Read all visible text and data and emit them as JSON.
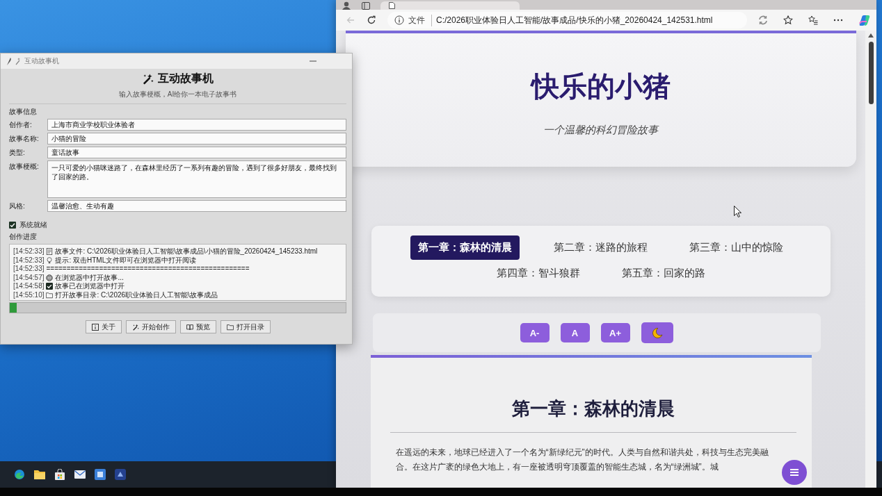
{
  "app_window": {
    "title": "互动故事机",
    "heading": "互动故事机",
    "subtitle": "输入故事梗概，AI给你一本电子故事书",
    "section_title": "故事信息",
    "fields": [
      {
        "label": "创作者:",
        "value": "上海市商业学校职业体验者",
        "kind": "line"
      },
      {
        "label": "故事名称:",
        "value": "小猫的冒险",
        "kind": "line"
      },
      {
        "label": "类型:",
        "value": "童话故事",
        "kind": "line"
      },
      {
        "label": "故事梗概:",
        "value": "一只可爱的小猫咪迷路了，在森林里经历了一系列有趣的冒险，遇到了很多好朋友，最终找到了回家的路。",
        "kind": "area"
      },
      {
        "label": "风格:",
        "value": "温馨治愈、生动有趣",
        "kind": "line"
      }
    ],
    "status": {
      "label": "系统就绪",
      "checked": true
    },
    "log_title": "创作进度",
    "log": [
      {
        "time": "[14:52:33]",
        "kind": "document",
        "text": "故事文件: C:\\2026职业体验日人工智能\\故事成品\\小猫的冒险_20260424_145233.html"
      },
      {
        "time": "[14:52:33]",
        "kind": "tip",
        "text": "提示: 双击HTML文件即可在浏览器中打开阅读"
      },
      {
        "time": "[14:52:33]",
        "kind": "plain",
        "text": "=================================================="
      },
      {
        "time": "[14:54:57]",
        "kind": "globe",
        "text": "在浏览器中打开故事..."
      },
      {
        "time": "[14:54:58]",
        "kind": "done",
        "text": "故事已在浏览器中打开"
      },
      {
        "time": "[14:55:10]",
        "kind": "folder",
        "text": "打开故事目录: C:\\2026职业体验日人工智能\\故事成品"
      }
    ],
    "progress": {
      "level": 0.02
    },
    "buttons": [
      {
        "label": "关于",
        "kind": "info"
      },
      {
        "label": "开始创作",
        "kind": "create"
      },
      {
        "label": "预览",
        "kind": "preview"
      },
      {
        "label": "打开目录",
        "kind": "folder"
      }
    ]
  },
  "browser": {
    "back_button": {
      "disabled": true
    },
    "address": {
      "scheme": "文件",
      "url": "C:/2026职业体验日人工智能/故事成品/快乐的小猪_20260424_142531.html"
    },
    "page": {
      "title": "快乐的小猪",
      "subtitle": "一个温馨的科幻冒险故事",
      "chapters": [
        {
          "label": "第一章：森林的清晨",
          "selected": true
        },
        {
          "label": "第二章：迷路的旅程",
          "selected": false
        },
        {
          "label": "第三章：山中的惊险",
          "selected": false
        },
        {
          "label": "第四章：智斗狼群",
          "selected": false
        },
        {
          "label": "第五章：回家的路",
          "selected": false
        }
      ],
      "font_controls": [
        {
          "kind": "text",
          "label": "A-"
        },
        {
          "kind": "text",
          "label": "A"
        },
        {
          "kind": "text",
          "label": "A+"
        },
        {
          "kind": "theme"
        }
      ],
      "chapter": {
        "title": "第一章：森林的清晨",
        "paragraph": "在遥远的未来，地球已经进入了一个名为“新绿纪元”的时代。人类与自然和谐共处，科技与生态完美融合。在这片广袤的绿色大地上，有一座被透明穹顶覆盖的智能生态城，名为“绿洲城”。城"
      }
    }
  }
}
